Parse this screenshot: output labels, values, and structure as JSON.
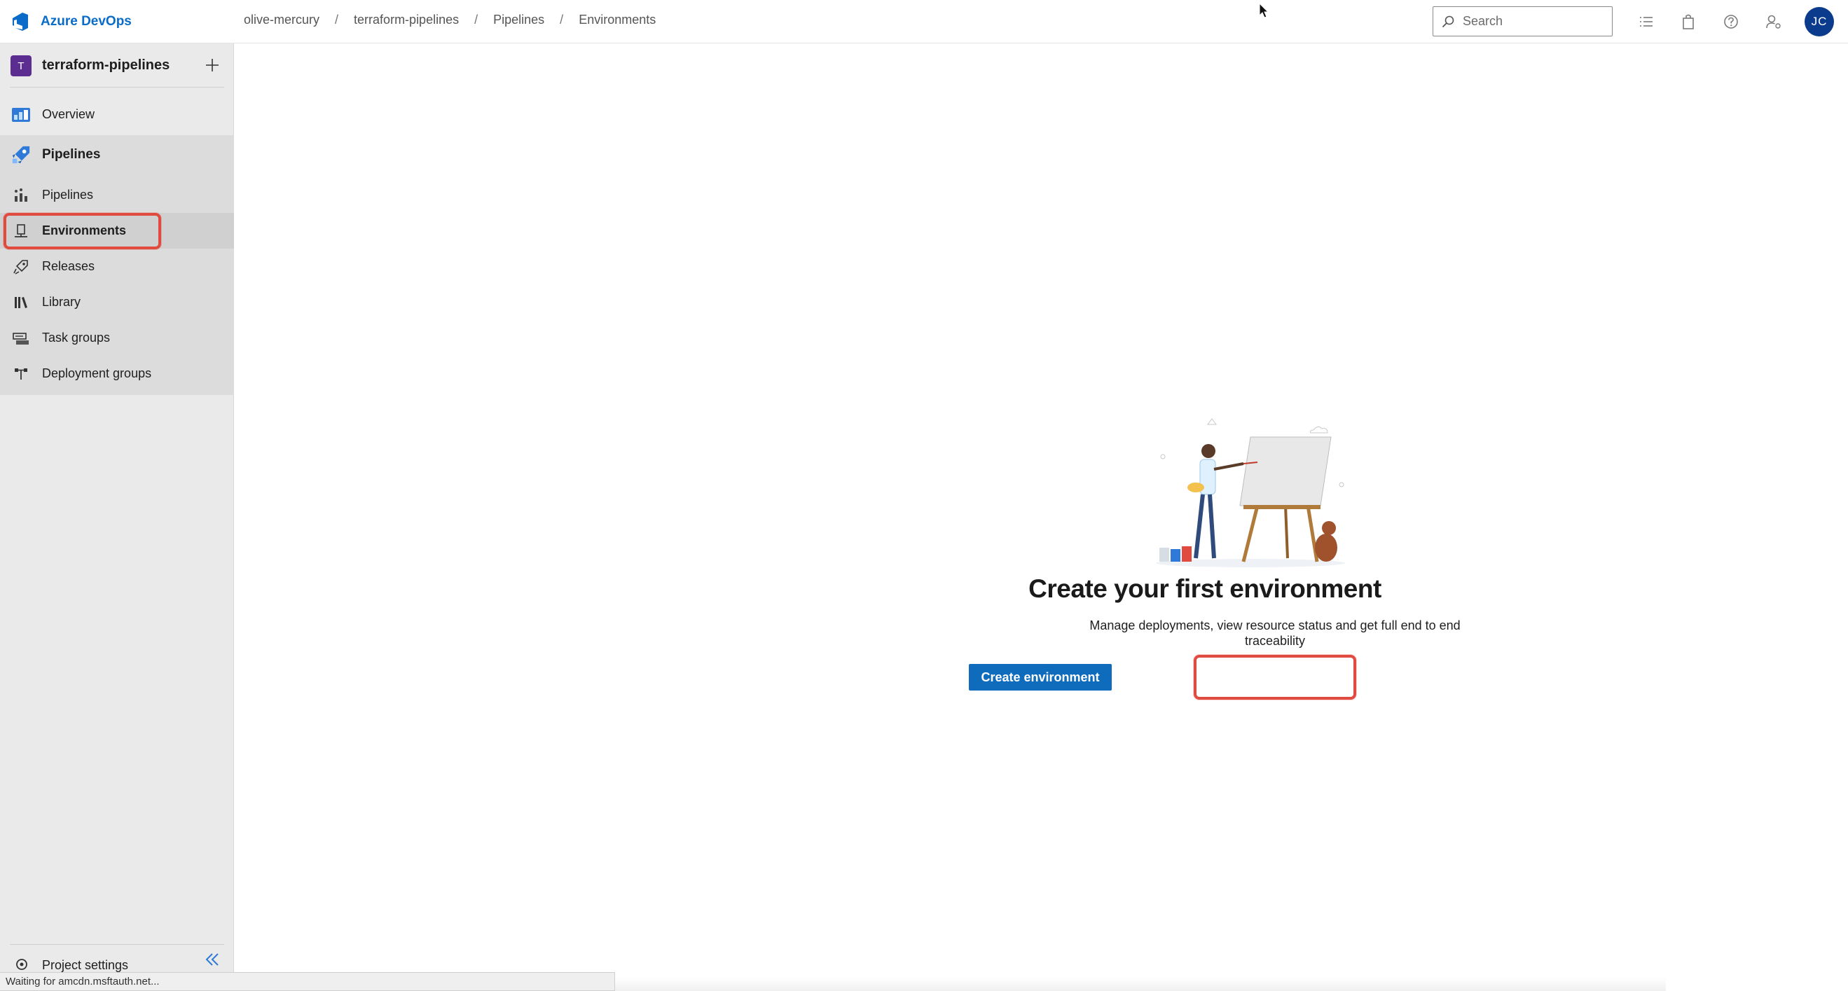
{
  "app": {
    "brand_name": "Azure DevOps",
    "accent_color": "#0a6cc8"
  },
  "breadcrumb": {
    "items": [
      "olive-mercury",
      "terraform-pipelines",
      "Pipelines",
      "Environments"
    ],
    "separator": "/"
  },
  "search": {
    "placeholder": "Search"
  },
  "header_icons": [
    "work-items-icon",
    "marketplace-bag-icon",
    "help-icon",
    "user-settings-icon"
  ],
  "user": {
    "initials": "JC"
  },
  "sidebar": {
    "project_badge": "T",
    "project_name": "terraform-pipelines",
    "items": [
      {
        "label": "Overview",
        "icon": "overview-icon"
      },
      {
        "label": "Pipelines",
        "icon": "pipelines-rocket-icon",
        "group_head": true
      },
      {
        "label": "Pipelines",
        "icon": "pipelines-icon"
      },
      {
        "label": "Environments",
        "icon": "environments-icon",
        "active": true
      },
      {
        "label": "Releases",
        "icon": "releases-icon"
      },
      {
        "label": "Library",
        "icon": "library-icon"
      },
      {
        "label": "Task groups",
        "icon": "task-groups-icon"
      },
      {
        "label": "Deployment groups",
        "icon": "deployment-groups-icon"
      }
    ],
    "project_settings_label": "Project settings"
  },
  "empty_state": {
    "title": "Create your first environment",
    "description_line1": "Manage deployments, view resource status and get full end to end",
    "description_line2": "traceability",
    "button_label": "Create environment"
  },
  "status_bar": {
    "text": "Waiting for amcdn.msftauth.net..."
  },
  "colors": {
    "highlight": "#e04a3f",
    "primary_button": "#0f6cbd",
    "avatar_bg": "#0b3b8c",
    "project_badge_bg": "#5c2d91"
  }
}
